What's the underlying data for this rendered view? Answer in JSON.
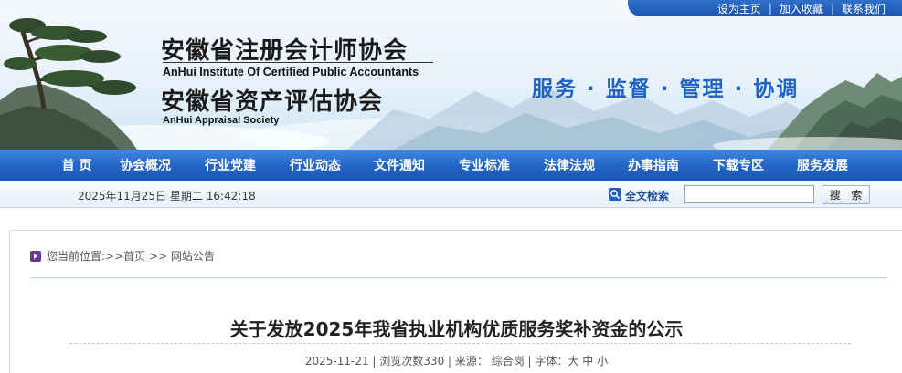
{
  "top_links": [
    "设为主页",
    "加入收藏",
    "联系我们"
  ],
  "top_links_separator": "|",
  "org": {
    "name_1": "安徽省注册会计师协会",
    "name_1_en": "AnHui Institute Of Certified Public Accountants",
    "name_2": "安徽省资产评估协会",
    "name_2_en": "AnHui Appraisal Society"
  },
  "slogan": "服务 · 监督 · 管理 · 协调",
  "nav": [
    "首 页",
    "协会概况",
    "行业党建",
    "行业动态",
    "文件通知",
    "专业标准",
    "法律法规",
    "办事指南",
    "下载专区",
    "服务发展"
  ],
  "info_bar": {
    "datetime": "2025年11月25日 星期二 16:42:18",
    "search_label": "全文检索",
    "search_value": "",
    "search_button": "搜 索"
  },
  "breadcrumb": {
    "prefix": "您当前位置:>>",
    "items": [
      "首页",
      "网站公告"
    ],
    "separator": " >> "
  },
  "article": {
    "title": "关于发放2025年我省执业机构优质服务奖补资金的公示",
    "date": "2025-11-21",
    "views_label": "浏览次数",
    "views": "330",
    "source_label": "来源：",
    "source": "综合岗",
    "font_label": "字体：",
    "font_sizes": [
      "大",
      "中",
      "小"
    ]
  },
  "colors": {
    "nav_blue": "#2568c9",
    "slogan_blue": "#1e63c4",
    "top_bar_blue": "#1f55b0"
  },
  "icons": [
    "pine-tree-icon",
    "search-icon",
    "breadcrumb-arrow-icon"
  ]
}
